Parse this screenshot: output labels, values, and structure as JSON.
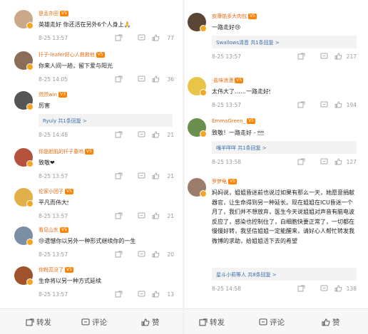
{
  "left": {
    "comments": [
      {
        "name": "是孟亦田",
        "badge": "V5",
        "text": "英雄走好  你还活在另外6个人身上🙏",
        "time": "8-25 13:57",
        "likes": "77"
      },
      {
        "name": "扦子-leafer好心人救救他",
        "badge": "V5",
        "text": "你来人间一趟，留下爱与阳光",
        "time": "8-25 14:05",
        "likes": "36"
      },
      {
        "name": "然然win",
        "badge": "V3",
        "text": "厉害",
        "reply": "Ryuly 共1条回复 >",
        "time": "8-25 14:48",
        "likes": "21"
      },
      {
        "name": "你是胆肌的扦子童呜",
        "badge": "V5",
        "text": "致敬❤",
        "time": "8-25 13:57",
        "likes": "21"
      },
      {
        "name": "伦家小团子",
        "badge": "V5",
        "text": "平凡而伟大🕯",
        "time": "8-25 13:57",
        "likes": "21"
      },
      {
        "name": "看见山东",
        "badge": "V5",
        "text": "😢遗憾你以另外一种形式继续你的一生",
        "time": "8-25 13:57",
        "likes": "20"
      },
      {
        "name": "你粉蕊没了",
        "badge": "V5",
        "text": "生命将以另一种方式延续",
        "time": "8-25 13:57",
        "likes": "13"
      }
    ]
  },
  "right": {
    "comments": [
      {
        "name": "皮薄馅多大肉包",
        "badge": "V5",
        "text": "一路走好😢",
        "reply": "Swallows清音 共1条回复 >",
        "time": "8-25 13:57",
        "likes": "217"
      },
      {
        "name": "·盐味浪漫",
        "badge": "V5",
        "text": "太伟大了……一路走好🕯",
        "time": "8-25 13:57",
        "likes": "194"
      },
      {
        "name": "EmmaGreen_",
        "badge": "V5",
        "text": "致敬！一路走好 - 🕯🕯🕯🕯",
        "reply": "嘎羊咩咩 共1条回复 >",
        "time": "8-25 13:58",
        "likes": "127"
      },
      {
        "name": "罗梦龟",
        "badge": "V5",
        "text": "妈妈说，姐姐昏迷前也说过如果有那么一天，她愿意捐献器官，让生命得到另一种延长。现在姐姐在ICU昏迷一个月了，我们并不想放弃，医生今天说姐姐对声音有脑电波反应了，感染也控制住了，白细胞快要正常了，一切都在慢慢好转，我坚信姐姐一定能醒来，请好心人帮忙转发我微博的求助，给姐姐活下去的希望",
        "reply": "星斗小莉等人 共8条回复 >",
        "time": "8-25 14:58",
        "likes": "138"
      }
    ]
  },
  "bottom_bar": {
    "repost": "转发",
    "comment": "评论",
    "like": "赞"
  }
}
